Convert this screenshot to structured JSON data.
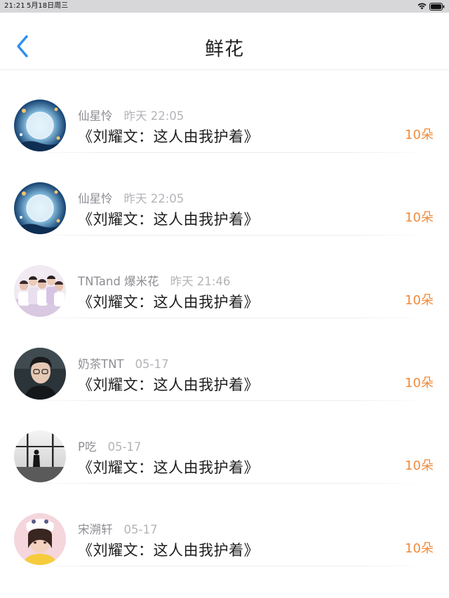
{
  "status_bar": {
    "time": "21:21",
    "date": "5月18日周三"
  },
  "header": {
    "title": "鲜花"
  },
  "items": [
    {
      "username": "仙星怜",
      "time": "昨天 22:05",
      "book": "《刘耀文：这人由我护着》",
      "count": "10朵",
      "avatar": "moon-fantasy"
    },
    {
      "username": "仙星怜",
      "time": "昨天 22:05",
      "book": "《刘耀文：这人由我护着》",
      "count": "10朵",
      "avatar": "moon-fantasy"
    },
    {
      "username": "TNTand 爆米花",
      "time": "昨天 21:46",
      "book": "《刘耀文：这人由我护着》",
      "count": "10朵",
      "avatar": "group-photo"
    },
    {
      "username": "奶茶TNT",
      "time": "05-17",
      "book": "《刘耀文：这人由我护着》",
      "count": "10朵",
      "avatar": "portrait-dark"
    },
    {
      "username": "P吃",
      "time": "05-17",
      "book": "《刘耀文：这人由我护着》",
      "count": "10朵",
      "avatar": "silhouette-window"
    },
    {
      "username": "宋溯轩",
      "time": "05-17",
      "book": "《刘耀文：这人由我护着》",
      "count": "10朵",
      "avatar": "portrait-yellow"
    }
  ],
  "colors": {
    "accent_blue": "#2e8ff0",
    "count_orange": "#f08a3c"
  }
}
